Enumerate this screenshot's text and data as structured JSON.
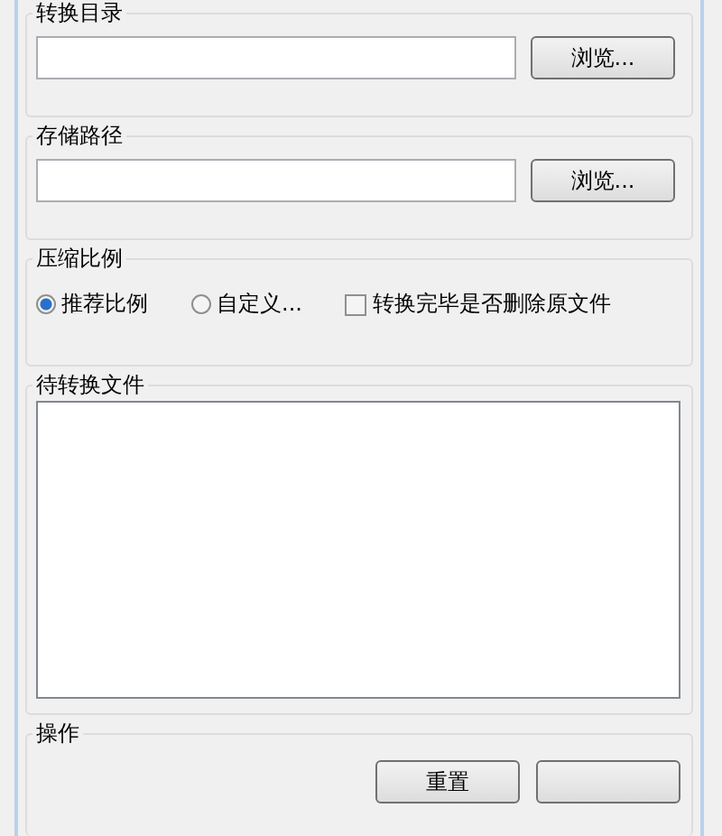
{
  "groups": [
    {
      "kind": "path",
      "title": "转换目录",
      "button": "浏览..."
    },
    {
      "kind": "path",
      "title": "存储路径",
      "button": "浏览..."
    },
    {
      "kind": "options",
      "title": "压缩比例",
      "radios": [
        {
          "label": "推荐比例",
          "selected": true
        },
        {
          "label": "自定义...",
          "selected": false
        }
      ],
      "checkbox": {
        "label": "转换完毕是否删除原文件",
        "checked": false
      }
    },
    {
      "kind": "list",
      "title": "待转换文件"
    },
    {
      "kind": "actions",
      "title": "操作",
      "buttons": [
        {
          "kind": "labeled",
          "label": "重置"
        },
        {
          "kind": "covered"
        }
      ]
    }
  ]
}
